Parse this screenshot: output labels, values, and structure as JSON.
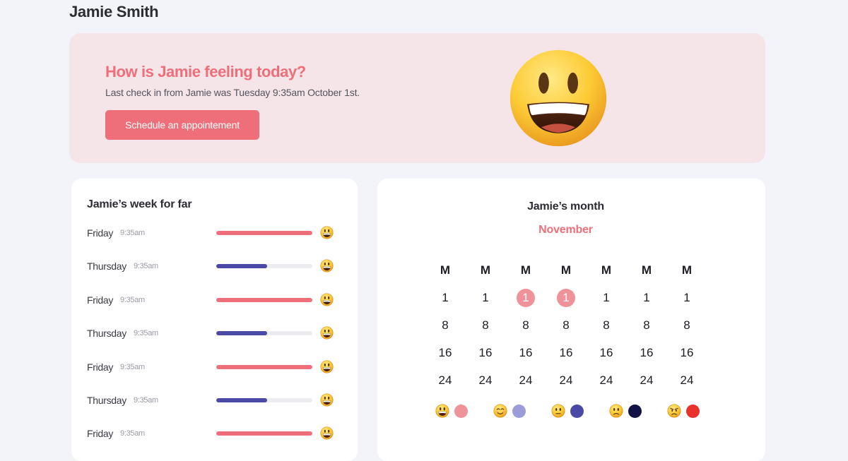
{
  "user": {
    "name": "Jamie Smith"
  },
  "hero": {
    "question": "How is Jamie feeling today?",
    "last_checkin": "Last check in from Jamie was Tuesday 9:35am October 1st.",
    "button_label": "Schedule an appointement",
    "mood_icon": "grinning-face-icon",
    "accent_color": "#ee6f7a",
    "background_color": "#f5e4e8"
  },
  "week": {
    "title": "Jamie’s week for far",
    "entries": [
      {
        "day": "Friday",
        "time": "9:35am",
        "level": 1.0,
        "color": "#ee6f7a",
        "mood_icon": "grinning-face-icon"
      },
      {
        "day": "Thursday",
        "time": "9:35am",
        "level": 0.53,
        "color": "#4a4aa6",
        "mood_icon": "grinning-face-icon"
      },
      {
        "day": "Friday",
        "time": "9:35am",
        "level": 1.0,
        "color": "#ee6f7a",
        "mood_icon": "grinning-face-icon"
      },
      {
        "day": "Thursday",
        "time": "9:35am",
        "level": 0.53,
        "color": "#4a4aa6",
        "mood_icon": "grinning-face-icon"
      },
      {
        "day": "Friday",
        "time": "9:35am",
        "level": 1.0,
        "color": "#ee6f7a",
        "mood_icon": "grinning-face-icon"
      },
      {
        "day": "Thursday",
        "time": "9:35am",
        "level": 0.53,
        "color": "#4a4aa6",
        "mood_icon": "grinning-face-icon"
      },
      {
        "day": "Friday",
        "time": "9:35am",
        "level": 1.0,
        "color": "#ee6f7a",
        "mood_icon": "grinning-face-icon"
      }
    ]
  },
  "month": {
    "title": "Jamie’s month",
    "name": "November",
    "weekdays": [
      "M",
      "M",
      "M",
      "M",
      "M",
      "M",
      "M"
    ],
    "rows": [
      [
        "1",
        "1",
        "1",
        "1",
        "1",
        "1",
        "1"
      ],
      [
        "8",
        "8",
        "8",
        "8",
        "8",
        "8",
        "8"
      ],
      [
        "16",
        "16",
        "16",
        "16",
        "16",
        "16",
        "16"
      ],
      [
        "24",
        "24",
        "24",
        "24",
        "24",
        "24",
        "24"
      ]
    ],
    "highlighted": [
      [
        0,
        2
      ],
      [
        0,
        3
      ]
    ],
    "highlight_color": "#ef929a",
    "legend": [
      {
        "mood_icon": "grinning-face-icon",
        "color": "#ef929a"
      },
      {
        "mood_icon": "smiling-face-icon",
        "color": "#9c9cd8"
      },
      {
        "mood_icon": "neutral-face-icon",
        "color": "#4a4aa6"
      },
      {
        "mood_icon": "slightly-frowning-face-icon",
        "color": "#121245"
      },
      {
        "mood_icon": "angry-face-icon",
        "color": "#e8322b"
      }
    ]
  }
}
